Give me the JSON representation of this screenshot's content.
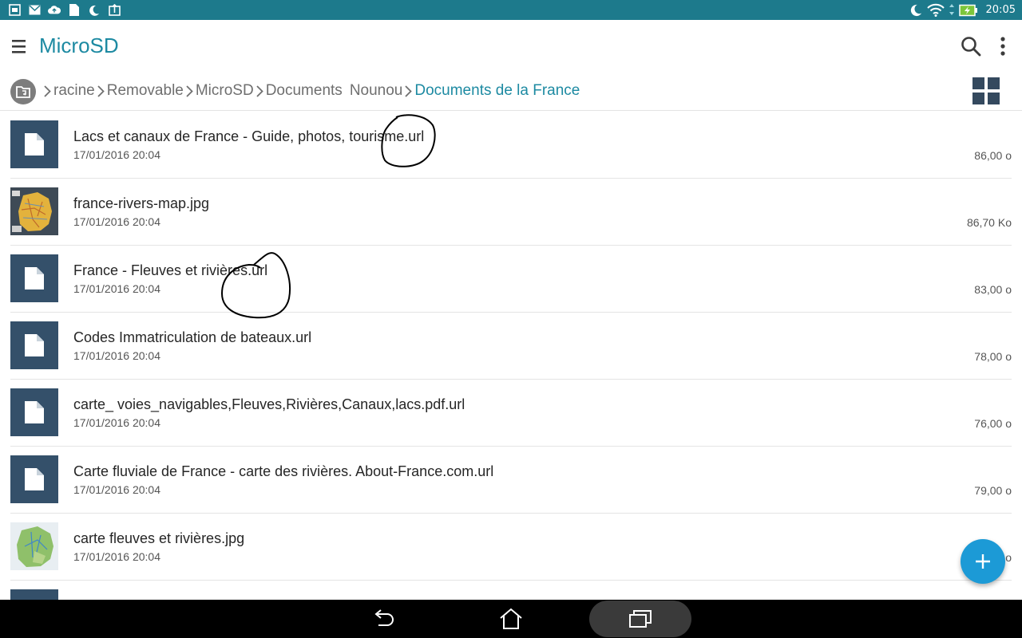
{
  "status_bar": {
    "time": "20:05",
    "left_icons": [
      "screenshot-icon",
      "mail-icon",
      "cloud-upload-icon",
      "file-icon",
      "night-mode-icon",
      "image-upload-icon"
    ],
    "right_icons": [
      "moon-icon",
      "wifi-icon",
      "battery-charging-icon"
    ]
  },
  "app_bar": {
    "title": "MicroSD"
  },
  "breadcrumb": {
    "items": [
      "racine",
      "Removable",
      "MicroSD",
      "Documents",
      "Nounou",
      "Documents de la France"
    ]
  },
  "files": [
    {
      "name": "Lacs et canaux de France - Guide, photos, tourisme.url",
      "date": "17/01/2016 20:04",
      "size": "86,00 o",
      "type": "document"
    },
    {
      "name": "france-rivers-map.jpg",
      "date": "17/01/2016 20:04",
      "size": "86,70 Ko",
      "type": "image-map"
    },
    {
      "name": "France - Fleuves et rivières.url",
      "date": "17/01/2016 20:04",
      "size": "83,00 o",
      "type": "document"
    },
    {
      "name": "Codes Immatriculation de bateaux.url",
      "date": "17/01/2016 20:04",
      "size": "78,00 o",
      "type": "document"
    },
    {
      "name": "carte_ voies_navigables,Fleuves,Rivières,Canaux,lacs.pdf.url",
      "date": "17/01/2016 20:04",
      "size": "76,00 o",
      "type": "document"
    },
    {
      "name": "Carte fluviale de France - carte des rivières. About-France.com.url",
      "date": "17/01/2016 20:04",
      "size": "79,00 o",
      "type": "document"
    },
    {
      "name": "carte fleuves et rivières.jpg",
      "date": "17/01/2016 20:04",
      "size": "o",
      "type": "image-green-map"
    }
  ],
  "colors": {
    "status_bar": "#1d7a8c",
    "accent": "#1d8aa2",
    "doc_thumb": "#34506a",
    "fab": "#1c9ad6"
  }
}
